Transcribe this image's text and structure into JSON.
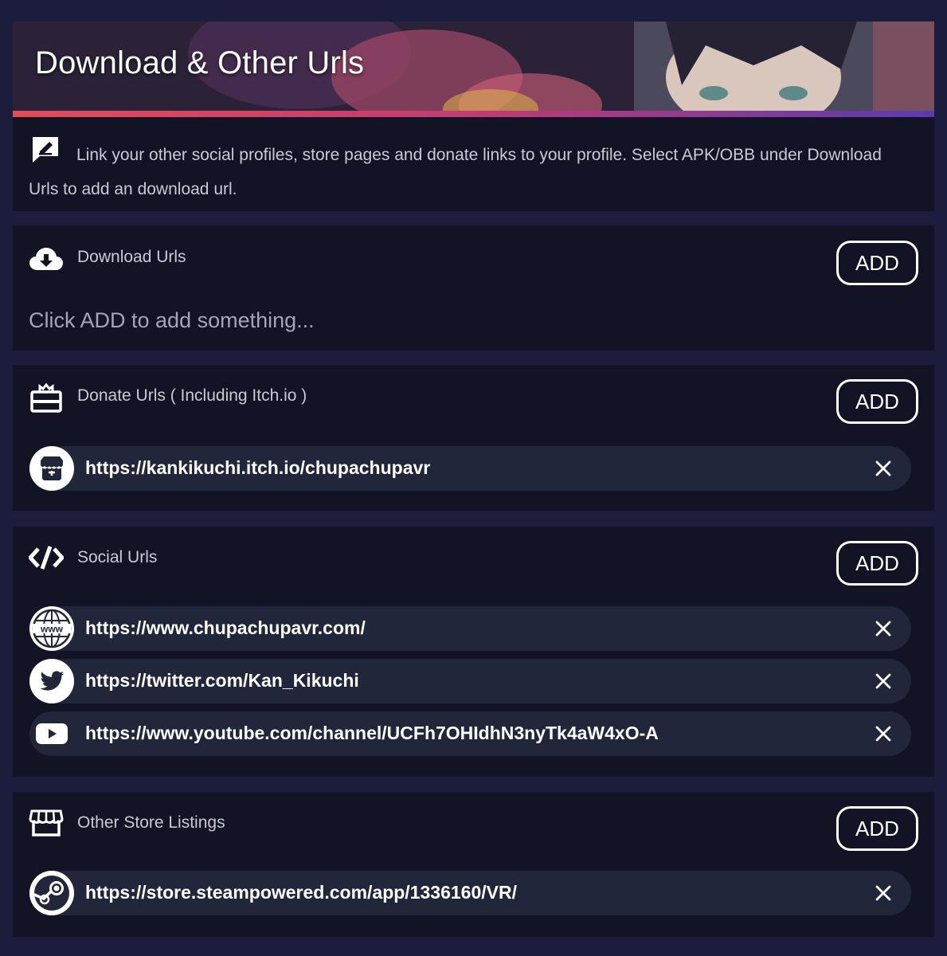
{
  "header": {
    "title": "Download & Other Urls"
  },
  "info": {
    "icon": "edit-icon",
    "text": "Link your other social profiles, store pages and donate links to your profile. Select APK/OBB under Download Urls to add an download url."
  },
  "sections": {
    "download": {
      "icon": "cloud-download-icon",
      "title": "Download Urls",
      "add_label": "ADD",
      "empty_text": "Click ADD to add something..."
    },
    "donate": {
      "icon": "donate-icon",
      "title": "Donate Urls ( Including Itch.io )",
      "add_label": "ADD",
      "items": [
        {
          "icon": "itchio-icon",
          "url": "https://kankikuchi.itch.io/chupachupavr"
        }
      ]
    },
    "social": {
      "icon": "code-icon",
      "title": "Social Urls",
      "add_label": "ADD",
      "items": [
        {
          "icon": "www-globe-icon",
          "url": "https://www.chupachupavr.com/"
        },
        {
          "icon": "twitter-icon",
          "url": "https://twitter.com/Kan_Kikuchi"
        },
        {
          "icon": "youtube-icon",
          "url": "https://www.youtube.com/channel/UCFh7OHIdhN3nyTk4aW4xO-A"
        }
      ]
    },
    "store": {
      "icon": "store-icon",
      "title": "Other Store Listings",
      "add_label": "ADD",
      "items": [
        {
          "icon": "steam-icon",
          "url": "https://store.steampowered.com/app/1336160/VR/"
        }
      ]
    }
  },
  "colors": {
    "page_bg": "#1c1d3c",
    "card_bg": "#121325",
    "row_bg": "#22263a",
    "accent_start": "#e34b57",
    "accent_end": "#5a3bb0"
  }
}
